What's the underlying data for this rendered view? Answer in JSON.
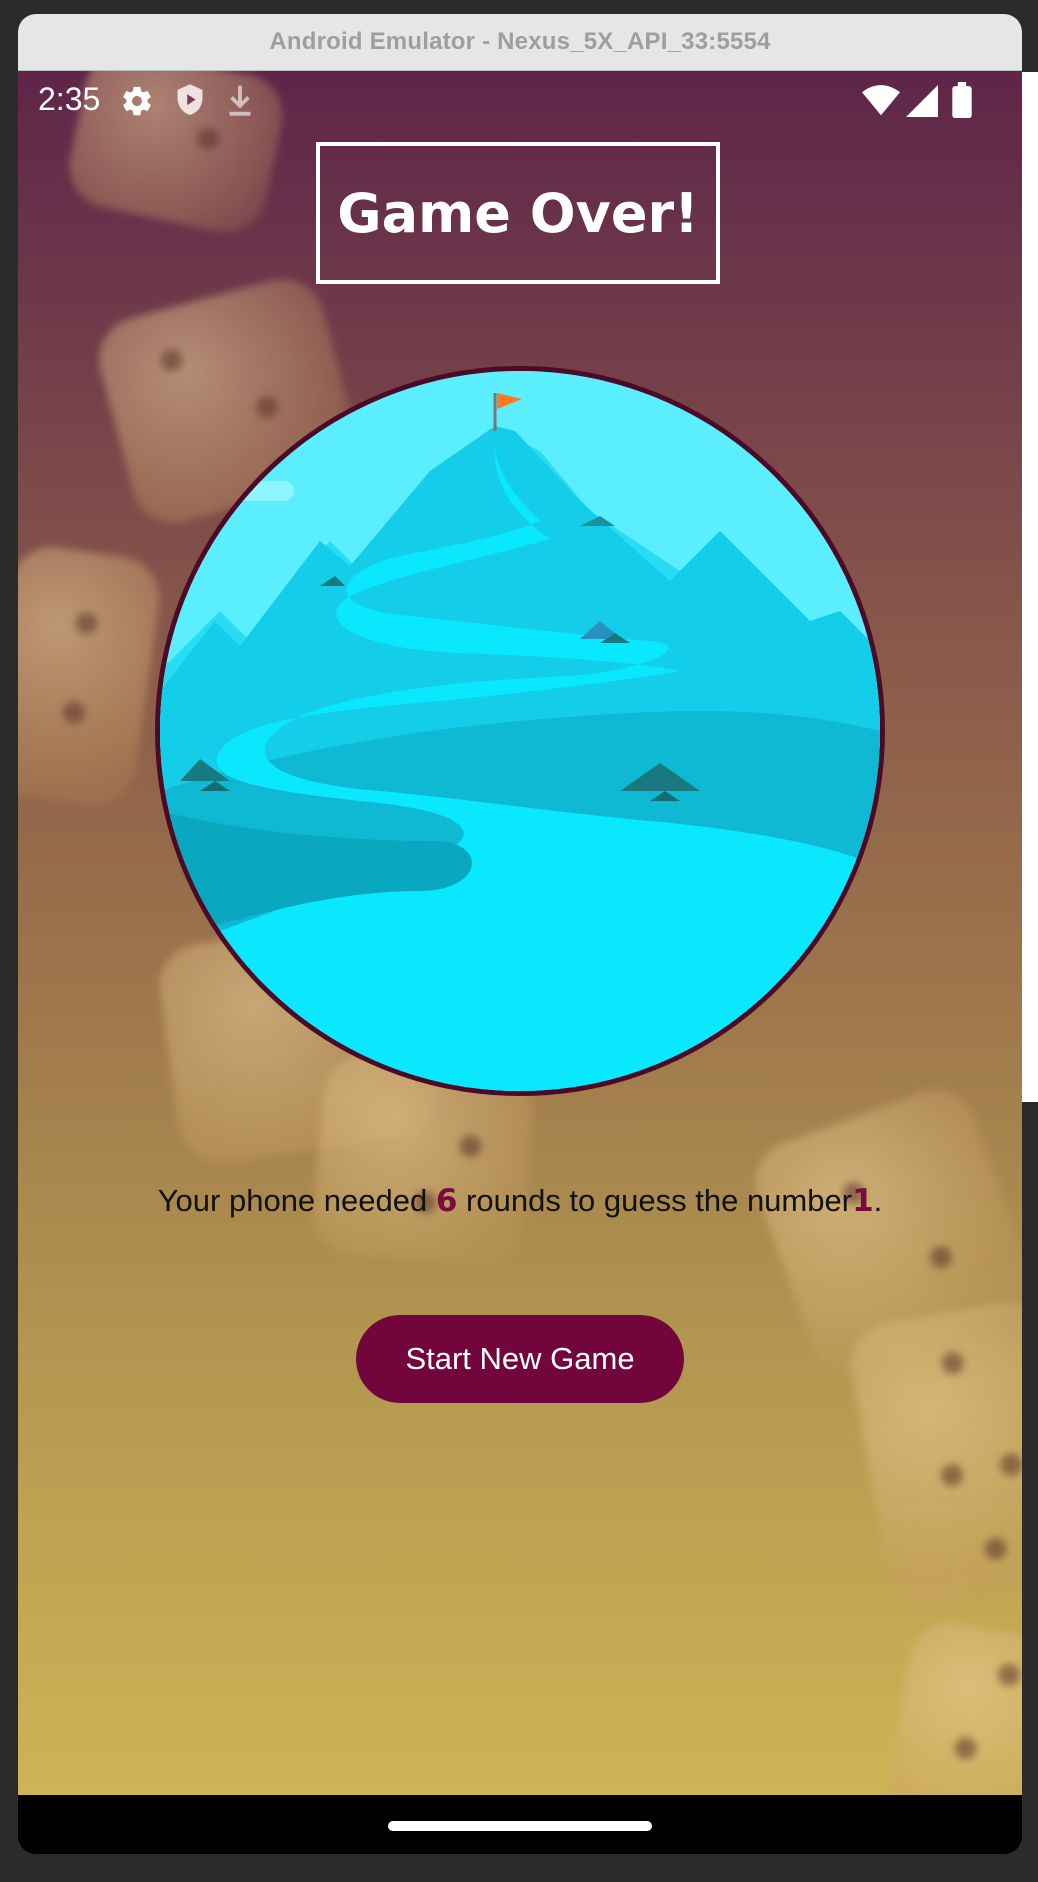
{
  "window": {
    "title": "Android Emulator - Nexus_5X_API_33:5554"
  },
  "statusbar": {
    "time": "2:35",
    "icons": [
      "gear-icon",
      "shield-play-icon",
      "download-icon",
      "wifi-icon",
      "signal-icon",
      "battery-icon"
    ]
  },
  "screen": {
    "title": "Game Over!",
    "image": "mountain-summit-illustration",
    "summary": {
      "prefix": "Your phone needed ",
      "rounds": "6",
      "middle": " rounds to guess the number",
      "number": "1",
      "suffix": "."
    },
    "button_label": "Start New Game"
  },
  "colors": {
    "accent": "#72063c",
    "highlight_text": "#7a0a3e",
    "bg_top": "#5f2549",
    "bg_bottom": "#cfb356",
    "circle_border": "#4c0a26"
  }
}
